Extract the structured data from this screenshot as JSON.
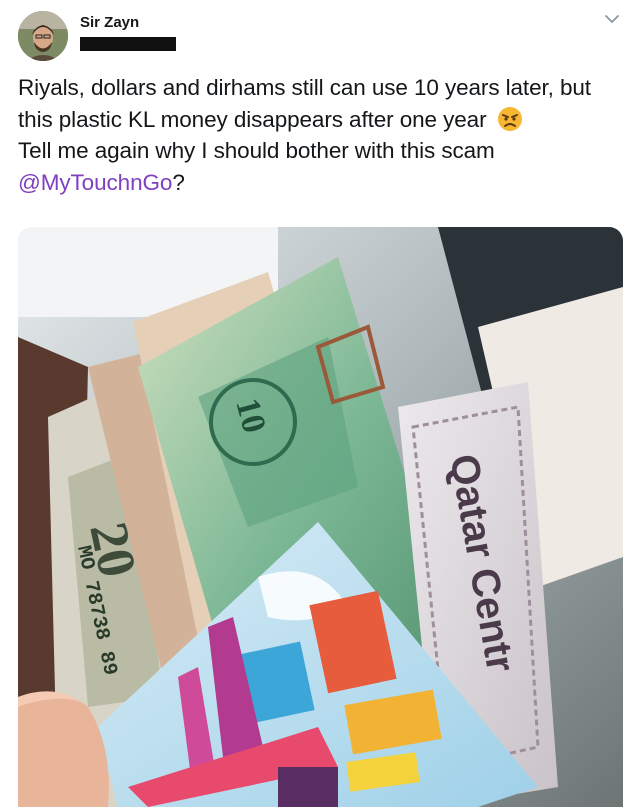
{
  "tweet": {
    "author_name": "Sir Zayn",
    "text_before_mention": "Riyals, dollars and dirhams still can use 10 years later, but this plastic KL money disappears after one year",
    "text_line3": "Tell me again why I should bother with this scam",
    "mention": "@MyTouchnGo",
    "text_after_mention": "?"
  },
  "photo": {
    "qatar_note_text": "Qatar Centr",
    "dirham_denomination": "10",
    "dollar_denomination": "20",
    "dollar_serial": "MO 78738 89"
  },
  "colors": {
    "mention": "#7f3fbf",
    "text": "#14171a"
  },
  "icons": {
    "menu": "chevron-down-icon",
    "emoji": "angry-face-emoji"
  }
}
